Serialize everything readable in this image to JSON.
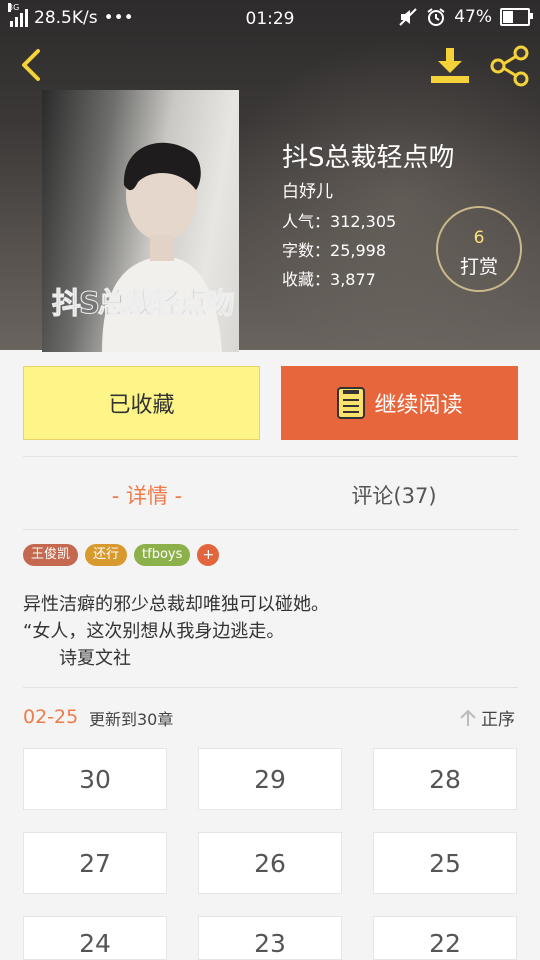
{
  "status_bar": {
    "network_type": "3G",
    "speed": "28.5K/s",
    "more": "•••",
    "time": "01:29",
    "battery_percent": "47%",
    "battery_level": 0.47
  },
  "book": {
    "title": "抖S总裁轻点吻",
    "cover_text": "抖S总裁轻点吻",
    "author": "白妤儿",
    "stats": [
      {
        "label": "人气：",
        "value": "312,305"
      },
      {
        "label": "字数：",
        "value": "25,998"
      },
      {
        "label": "收藏：",
        "value": "3,877"
      }
    ],
    "tip": {
      "count": "6",
      "label": "打赏"
    }
  },
  "actions": {
    "favorite_label": "已收藏",
    "read_label": "继续阅读"
  },
  "tabs": {
    "detail": "- 详情 -",
    "comments": "评论(37)"
  },
  "tags": [
    {
      "label": "王俊凯",
      "color": "#c4694f"
    },
    {
      "label": "还行",
      "color": "#d89a2e"
    },
    {
      "label": "tfboys",
      "color": "#8cb04a"
    }
  ],
  "tag_add": "+",
  "description": [
    "异性洁癖的邪少总裁却唯独可以碰她。",
    "“女人，这次别想从我身边逃走。",
    "诗夏文社"
  ],
  "update": {
    "date": "02-25",
    "text": "更新到30章",
    "order_label": "正序"
  },
  "chapters": [
    "30",
    "29",
    "28",
    "27",
    "26",
    "25",
    "24",
    "23",
    "22"
  ],
  "colors": {
    "accent": "#e8663b",
    "favorite_bg": "#fdf587",
    "tab_active": "#ef7b4b"
  }
}
